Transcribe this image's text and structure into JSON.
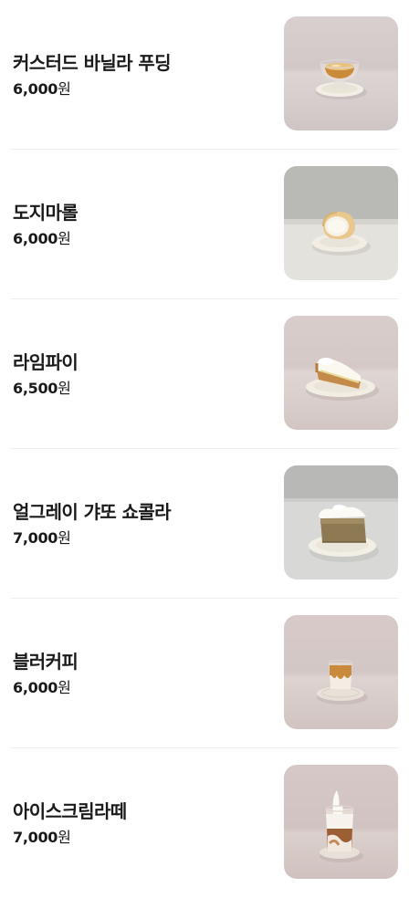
{
  "menu": {
    "items": [
      {
        "name": "커스터드 바닐라 푸딩",
        "price": "6,000",
        "currency": "원",
        "image": "custard-pudding-photo"
      },
      {
        "name": "도지마롤",
        "price": "6,000",
        "currency": "원",
        "image": "dojima-roll-photo"
      },
      {
        "name": "라임파이",
        "price": "6,500",
        "currency": "원",
        "image": "lime-pie-photo"
      },
      {
        "name": "얼그레이 갸또 쇼콜라",
        "price": "7,000",
        "currency": "원",
        "image": "earl-grey-gateau-chocolat-photo"
      },
      {
        "name": "블러커피",
        "price": "6,000",
        "currency": "원",
        "image": "blur-coffee-photo"
      },
      {
        "name": "아이스크림라떼",
        "price": "7,000",
        "currency": "원",
        "image": "ice-cream-latte-photo"
      }
    ]
  },
  "colors": {
    "text": "#1a1a1a",
    "divider": "#efefef",
    "background": "#ffffff"
  }
}
